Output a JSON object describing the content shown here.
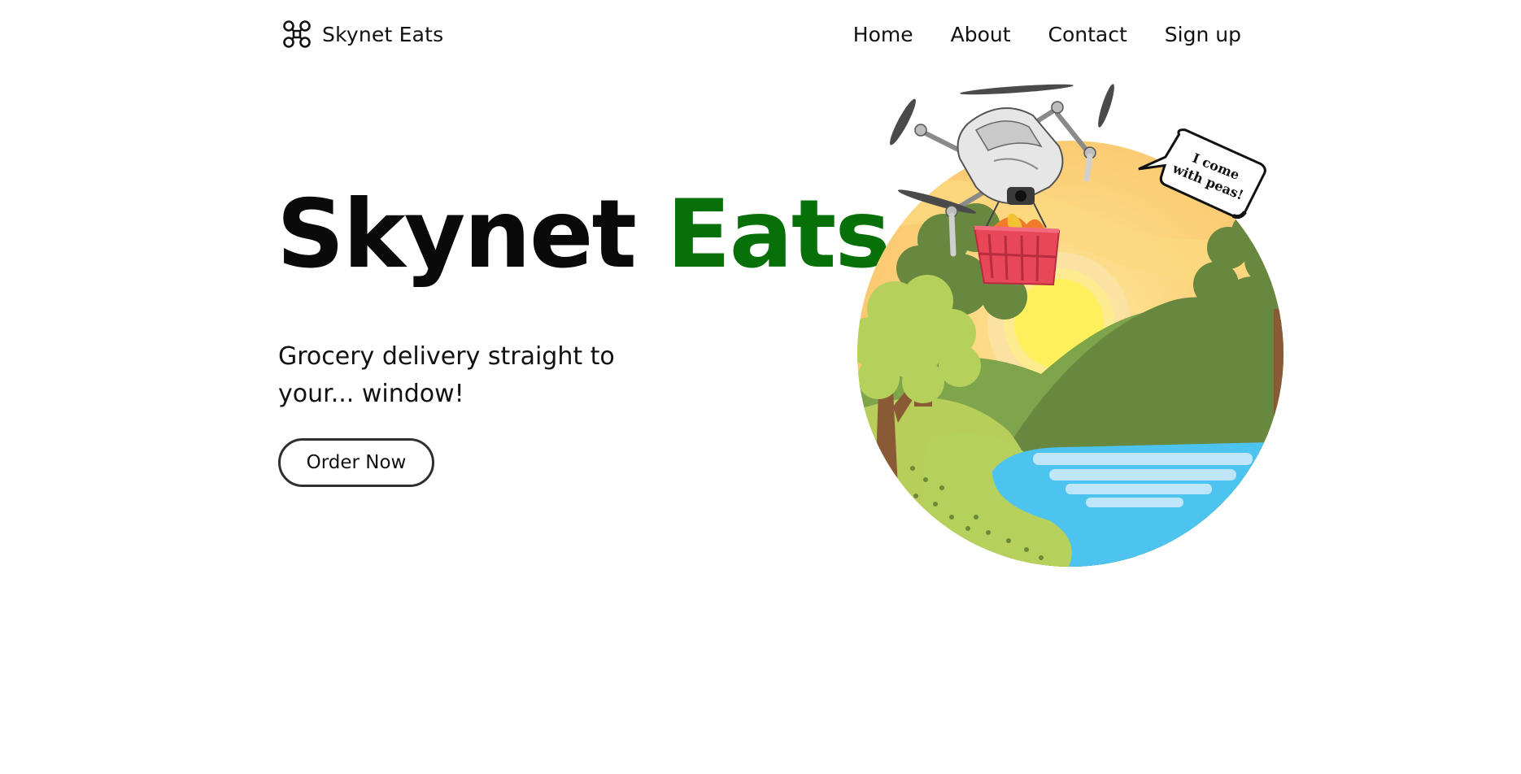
{
  "brand": {
    "name": "Skynet Eats",
    "logo_icon": "drone-icon"
  },
  "nav": {
    "items": [
      "Home",
      "About",
      "Contact",
      "Sign up"
    ]
  },
  "hero": {
    "title_part1": "Skynet",
    "title_part2": "Eats",
    "tagline": "Grocery delivery straight to your... window!",
    "cta_label": "Order Now",
    "speech_line1": "I come",
    "speech_line2": "with peas!"
  },
  "colors": {
    "accent": "#087008",
    "text": "#111111",
    "background": "#ffffff",
    "button_border": "#2f2f2f"
  }
}
